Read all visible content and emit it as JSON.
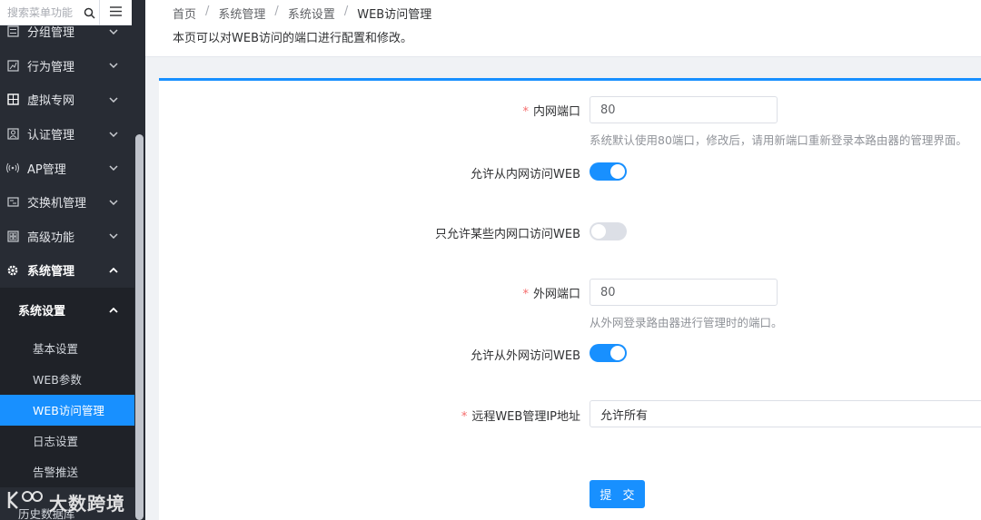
{
  "sidebar": {
    "search_placeholder": "搜索菜单功能",
    "items": [
      {
        "label": "分组管理",
        "icon": "list-icon"
      },
      {
        "label": "行为管理",
        "icon": "chart-icon"
      },
      {
        "label": "虚拟专网",
        "icon": "vpn-icon"
      },
      {
        "label": "认证管理",
        "icon": "user-card-icon"
      },
      {
        "label": "AP管理",
        "icon": "wifi-icon"
      },
      {
        "label": "交换机管理",
        "icon": "switch-icon"
      },
      {
        "label": "高级功能",
        "icon": "grid-icon"
      },
      {
        "label": "系统管理",
        "icon": "gear-icon"
      }
    ],
    "submenu_title": "系统设置",
    "leaves": [
      "基本设置",
      "WEB参数",
      "WEB访问管理",
      "日志设置",
      "告警推送"
    ],
    "cut_item": "历史数据库",
    "watermark": "大数跨境"
  },
  "breadcrumb": [
    "首页",
    "系统管理",
    "系统设置",
    "WEB访问管理"
  ],
  "page_desc": "本页可以对WEB访问的端口进行配置和修改。",
  "form": {
    "lan_port_label": "内网端口",
    "lan_port_value": "80",
    "lan_port_hint": "系统默认使用80端口，修改后，请用新端口重新登录本路由器的管理界面。",
    "allow_lan_label": "允许从内网访问WEB",
    "allow_lan": true,
    "only_some_lan_label": "只允许某些内网口访问WEB",
    "only_some_lan": false,
    "wan_port_label": "外网端口",
    "wan_port_value": "80",
    "wan_port_hint": "从外网登录路由器进行管理时的端口。",
    "allow_wan_label": "允许从外网访问WEB",
    "allow_wan": true,
    "remote_ip_label": "远程WEB管理IP地址",
    "remote_ip_value": "允许所有",
    "submit_label": "提 交"
  },
  "colors": {
    "primary": "#1890ff",
    "sidebar_bg": "#282c34",
    "required": "#f56c6c"
  }
}
